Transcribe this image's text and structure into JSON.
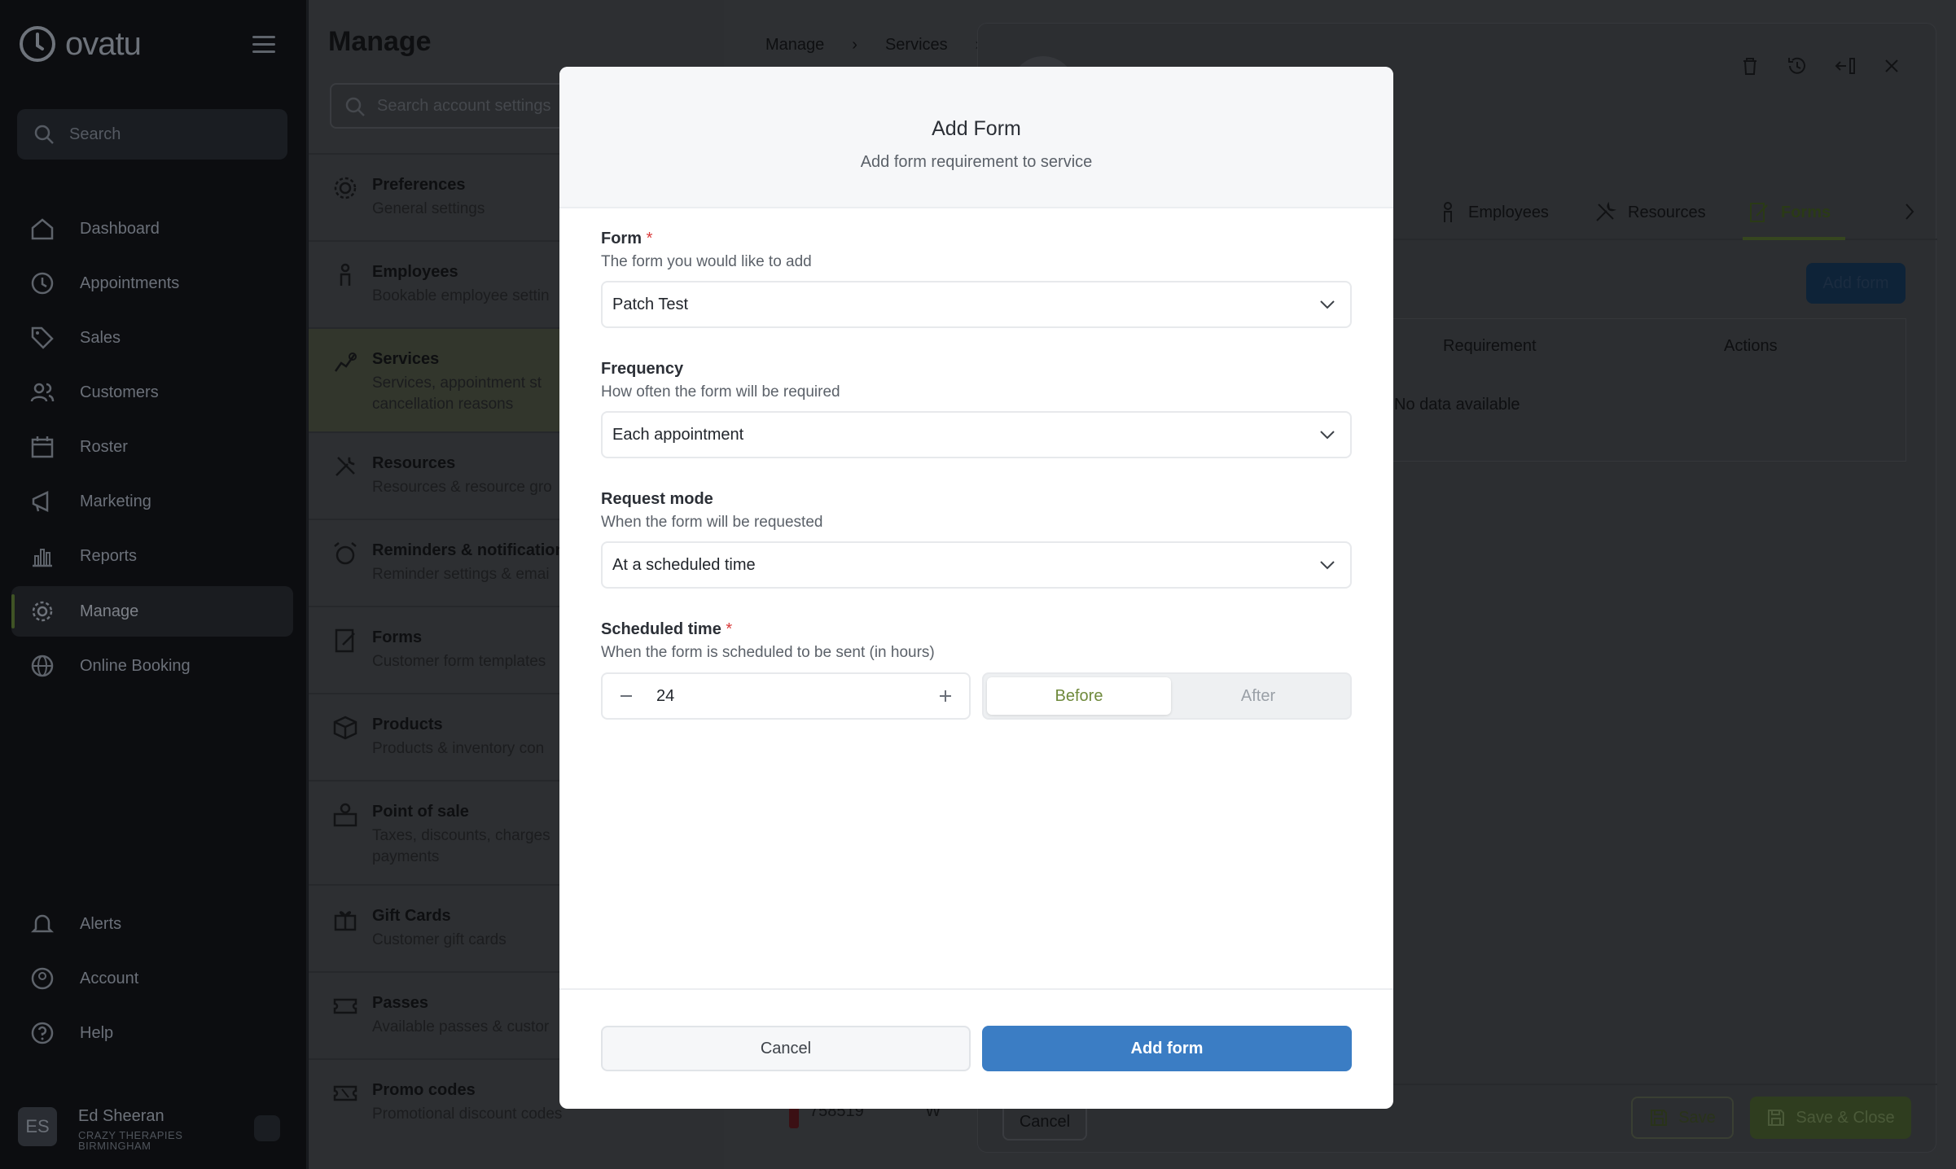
{
  "app": {
    "brand": "ovatu"
  },
  "sidebar": {
    "search_placeholder": "Search",
    "items": [
      {
        "label": "Dashboard",
        "icon": "home-icon"
      },
      {
        "label": "Appointments",
        "icon": "clock-icon"
      },
      {
        "label": "Sales",
        "icon": "tag-icon"
      },
      {
        "label": "Customers",
        "icon": "users-icon"
      },
      {
        "label": "Roster",
        "icon": "calendar-icon"
      },
      {
        "label": "Marketing",
        "icon": "megaphone-icon"
      },
      {
        "label": "Reports",
        "icon": "bar-chart-icon"
      },
      {
        "label": "Manage",
        "icon": "gear-icon",
        "active": true
      },
      {
        "label": "Online Booking",
        "icon": "globe-icon"
      }
    ],
    "bottom_items": [
      {
        "label": "Alerts",
        "icon": "bell-icon"
      },
      {
        "label": "Account",
        "icon": "account-icon"
      },
      {
        "label": "Help",
        "icon": "help-icon"
      }
    ],
    "user": {
      "initials": "ES",
      "name": "Ed Sheeran",
      "org": "CRAZY THERAPIES BIRMINGHAM"
    }
  },
  "manage": {
    "title": "Manage",
    "search_placeholder": "Search account settings",
    "items": [
      {
        "title": "Preferences",
        "sub": "General settings"
      },
      {
        "title": "Employees",
        "sub": "Bookable employee settin"
      },
      {
        "title": "Services",
        "sub": "Services, appointment st",
        "sub2": "cancellation reasons",
        "active": true
      },
      {
        "title": "Resources",
        "sub": "Resources & resource gro"
      },
      {
        "title": "Reminders & notifications",
        "sub": "Reminder settings & emai"
      },
      {
        "title": "Forms",
        "sub": "Customer form templates"
      },
      {
        "title": "Products",
        "sub": "Products & inventory con"
      },
      {
        "title": "Point of sale",
        "sub": "Taxes, discounts, charges",
        "sub2": "payments"
      },
      {
        "title": "Gift Cards",
        "sub": "Customer gift cards"
      },
      {
        "title": "Passes",
        "sub": "Available passes & custor"
      },
      {
        "title": "Promo codes",
        "sub": "Promotional discount codes"
      }
    ]
  },
  "breadcrumb": {
    "items": [
      "Manage",
      "Services"
    ]
  },
  "drawer": {
    "tabs": [
      "Employees",
      "Resources",
      "Forms"
    ],
    "active_tab": "Forms",
    "add_button": "Add form",
    "table": {
      "headers": [
        "Requirement",
        "Actions"
      ],
      "empty": "No data available"
    },
    "cancel": "Cancel",
    "save": "Save",
    "save_close": "Save & Close",
    "list_fragment": {
      "code": "758519",
      "mark": "W"
    }
  },
  "modal": {
    "title": "Add Form",
    "subtitle": "Add form requirement to service",
    "form": {
      "label": "Form",
      "help": "The form you would like to add",
      "value": "Patch Test"
    },
    "frequency": {
      "label": "Frequency",
      "help": "How often the form will be required",
      "value": "Each appointment"
    },
    "request_mode": {
      "label": "Request mode",
      "help": "When the form will be requested",
      "value": "At a scheduled time"
    },
    "scheduled_time": {
      "label": "Scheduled time",
      "help": "When the form is scheduled to be sent (in hours)",
      "value": "24",
      "options": [
        "Before",
        "After"
      ],
      "selected": "Before"
    },
    "required_mark": "*",
    "cancel": "Cancel",
    "submit": "Add form"
  },
  "colors": {
    "primary": "#3b7dc4",
    "accent_green": "#6f8a3c",
    "required": "#d93a3a"
  }
}
